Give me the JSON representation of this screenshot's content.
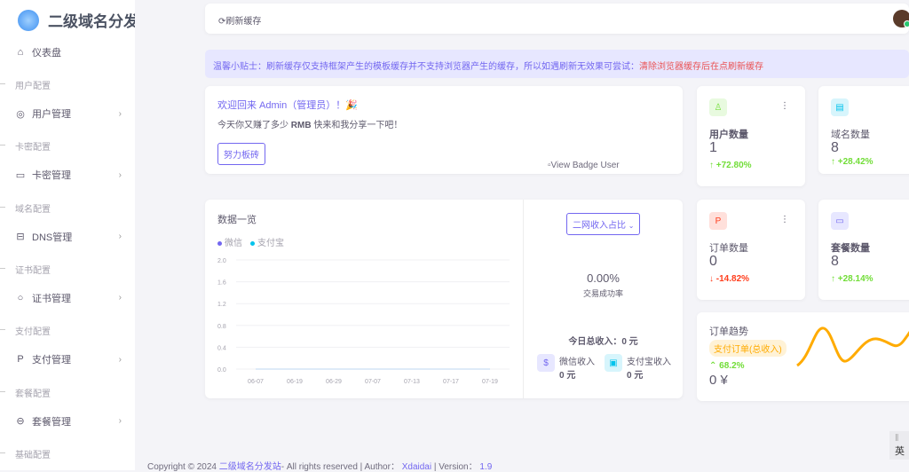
{
  "brand": {
    "title": "二级域名分发站"
  },
  "sidebar": {
    "dashboard": "仪表盘",
    "sections": [
      {
        "header": "用户配置",
        "item": "用户管理",
        "icon": "user-circle-icon",
        "glyph": "◎"
      },
      {
        "header": "卡密配置",
        "item": "卡密管理",
        "icon": "laptop-icon",
        "glyph": "▭"
      },
      {
        "header": "域名配置",
        "item": "DNS管理",
        "icon": "layout-icon",
        "glyph": "⊟"
      },
      {
        "header": "证书配置",
        "item": "证书管理",
        "icon": "circle-icon",
        "glyph": "○"
      },
      {
        "header": "支付配置",
        "item": "支付管理",
        "icon": "paypal-icon",
        "glyph": "P"
      },
      {
        "header": "套餐配置",
        "item": "套餐管理",
        "icon": "package-icon",
        "glyph": "⊖"
      },
      {
        "header": "基础配置"
      }
    ]
  },
  "topbar": {
    "refresh": "刷新缓存"
  },
  "tips": {
    "text": "温馨小贴士：刷新缓存仅支持框架产生的模板缓存并不支持浏览器产生的缓存，所以如遇刷新无效果可尝试：",
    "highlight": "清除浏览器缓存后在点刷新缓存"
  },
  "welcome": {
    "title": "欢迎回来 Admin（管理员）！🎉",
    "sub_a": "今天你又赚了多少 ",
    "sub_b": "RMB",
    "sub_c": " 快来和我分享一下吧！",
    "button": "努力板砖",
    "badge_alt": "View Badge User"
  },
  "stats": [
    {
      "label": "用户数量",
      "value": "1",
      "change": "+72.80%",
      "dir": "up",
      "color": "#71dd37",
      "bg": "#e8fadf"
    },
    {
      "label": "域名数量",
      "value": "8",
      "change": "+28.42%",
      "dir": "up",
      "color": "#03c3ec",
      "bg": "#d7f5fc"
    },
    {
      "label": "订单数量",
      "value": "0",
      "change": "-14.82%",
      "dir": "down",
      "color": "#ff3e1d",
      "bg": "#ffe0db"
    },
    {
      "label": "套餐数量",
      "value": "8",
      "change": "+28.14%",
      "dir": "up",
      "color": "#7367f0",
      "bg": "#e7e7ff"
    }
  ],
  "data_overview": {
    "title": "数据一览",
    "dropdown": "二网收入占比",
    "rate": "0.00%",
    "rate_label": "交易成功率",
    "today_total": "今日总收入：0 元",
    "wechat_label": "微信收入",
    "wechat_value": "0 元",
    "alipay_label": "支付宝收入",
    "alipay_value": "0 元"
  },
  "chart_data": {
    "type": "line",
    "categories": [
      "06-07",
      "06-19",
      "06-29",
      "07-07",
      "07-13",
      "07-17",
      "07-19"
    ],
    "series": [
      {
        "name": "微信",
        "color": "#7367f0",
        "values": [
          0,
          0,
          0,
          0,
          0,
          0,
          0
        ]
      },
      {
        "name": "支付宝",
        "color": "#03c3ec",
        "values": [
          0,
          0,
          0,
          0,
          0,
          0,
          0
        ]
      }
    ],
    "ylim": [
      0,
      2.0
    ],
    "yticks": [
      "0.0",
      "0.4",
      "0.8",
      "1.2",
      "1.6",
      "2.0"
    ],
    "grid": true,
    "legend": "top-left"
  },
  "trend": {
    "title": "订单趋势",
    "tag": "支付订单(总收入)",
    "change": "68.2%",
    "value": "0 ¥",
    "color": "#ffab00"
  },
  "lang": "英",
  "footer": {
    "a": "Copyright © 2024 ",
    "site": "二级域名分发站",
    "b": "- All rights reserved | Author：",
    "author": "Xdaidai",
    "c": " | Version：",
    "version": "1.9"
  }
}
